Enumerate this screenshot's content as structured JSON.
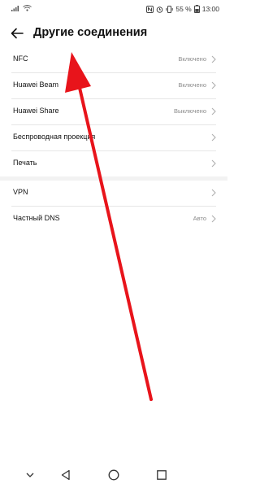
{
  "status_bar": {
    "battery": "55 %",
    "time": "13:00",
    "icons": [
      "signal-icon",
      "wifi-icon",
      "nfc-icon",
      "alarm-icon",
      "vibrate-icon",
      "battery-icon"
    ]
  },
  "header": {
    "back_icon": "back-arrow-icon",
    "title": "Другие соединения"
  },
  "settings": {
    "section1": [
      {
        "label": "NFC",
        "value": "Включено"
      },
      {
        "label": "Huawei Beam",
        "value": "Включено"
      },
      {
        "label": "Huawei Share",
        "value": "Выключено"
      },
      {
        "label": "Беспроводная проекция",
        "value": ""
      },
      {
        "label": "Печать",
        "value": ""
      }
    ],
    "section2": [
      {
        "label": "VPN",
        "value": ""
      },
      {
        "label": "Частный DNS",
        "value": "Авто"
      }
    ]
  },
  "annotation": {
    "color": "#e8141b",
    "icon": "red-arrow-annotation"
  },
  "nav_bar": {
    "buttons": [
      "collapse-icon",
      "back-triangle-icon",
      "home-circle-icon",
      "recents-square-icon"
    ]
  }
}
